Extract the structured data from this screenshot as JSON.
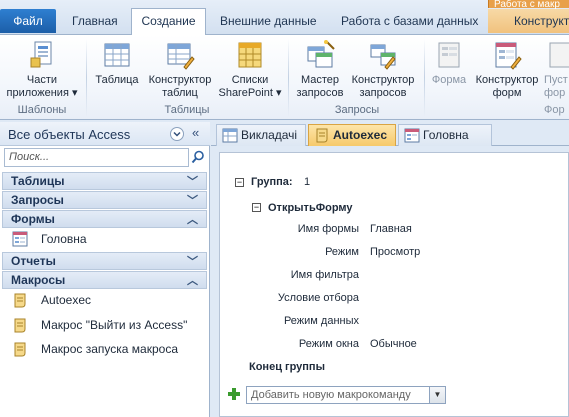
{
  "window": {
    "context_title": "Работа с макр"
  },
  "ribbon_tabs": {
    "file": "Файл",
    "home": "Главная",
    "create": "Создание",
    "external": "Внешние данные",
    "db": "Работа с базами данных",
    "constructor": "Конструкт"
  },
  "ribbon": {
    "buttons": {
      "parts": "Части\nприложения ▾",
      "table": "Таблица",
      "table_designer": "Конструктор\nтаблиц",
      "sharepoint": "Списки\nSharePoint ▾",
      "query_wizard": "Мастер\nзапросов",
      "query_designer": "Конструктор\nзапросов",
      "form": "Форма",
      "form_designer": "Конструктор\nформ",
      "blank_form": "Пуст\nфор"
    },
    "groups": {
      "templates": "Шаблоны",
      "tables": "Таблицы",
      "queries": "Запросы",
      "forms": "Фор"
    }
  },
  "nav": {
    "title": "Все объекты Access",
    "search_placeholder": "Поиск...",
    "categories": {
      "tables": "Таблицы",
      "queries": "Запросы",
      "forms": "Формы",
      "reports": "Отчеты",
      "macros": "Макросы"
    },
    "forms": [
      "Головна"
    ],
    "macros": [
      "Autoexec",
      "Макрос \"Выйти из Access\"",
      "Макрос запуска макроса"
    ]
  },
  "doc_tabs": {
    "tab1": "Викладачі",
    "tab2": "Autoexec",
    "tab3": "Головна"
  },
  "editor": {
    "group_label": "Группа:",
    "group_value": "1",
    "action": "ОткрытьФорму",
    "params": [
      {
        "label": "Имя формы",
        "value": "Главная"
      },
      {
        "label": "Режим",
        "value": "Просмотр"
      },
      {
        "label": "Имя фильтра",
        "value": ""
      },
      {
        "label": "Условие отбора",
        "value": ""
      },
      {
        "label": "Режим данных",
        "value": ""
      },
      {
        "label": "Режим окна",
        "value": "Обычное"
      }
    ],
    "end_group": "Конец группы",
    "add_placeholder": "Добавить новую макрокоманду"
  }
}
